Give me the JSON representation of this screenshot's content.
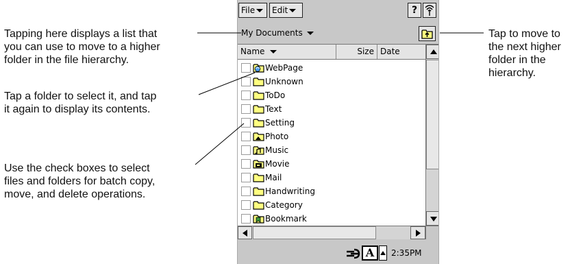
{
  "callouts": {
    "path_list": [
      "Tapping here displays a list that",
      "you can use to move to a higher",
      "folder in the file hierarchy."
    ],
    "select_folder": [
      "Tap a folder to select it, and tap",
      "it again to display its contents."
    ],
    "checkboxes": [
      "Use the check boxes to select",
      "files and folders for batch copy,",
      "move, and delete operations."
    ],
    "up_button": [
      "Tap to move to",
      "the next higher",
      "folder in the",
      "hierarchy."
    ]
  },
  "menubar": {
    "file_label": "File",
    "edit_label": "Edit",
    "help_label": "?",
    "signal_icon": "signal-icon"
  },
  "pathbar": {
    "current_folder": "My Documents",
    "up_icon": "up-folder-icon"
  },
  "list": {
    "columns": [
      "Name",
      "Size",
      "Date"
    ],
    "items": [
      {
        "name": "WebPage",
        "icon": "webpage-folder-icon"
      },
      {
        "name": "Unknown",
        "icon": "folder-icon"
      },
      {
        "name": "ToDo",
        "icon": "folder-icon"
      },
      {
        "name": "Text",
        "icon": "folder-icon"
      },
      {
        "name": "Setting",
        "icon": "folder-icon"
      },
      {
        "name": "Photo",
        "icon": "photo-folder-icon"
      },
      {
        "name": "Music",
        "icon": "music-folder-icon"
      },
      {
        "name": "Movie",
        "icon": "movie-folder-icon"
      },
      {
        "name": "Mail",
        "icon": "folder-icon"
      },
      {
        "name": "Handwriting",
        "icon": "folder-icon"
      },
      {
        "name": "Category",
        "icon": "folder-icon"
      },
      {
        "name": "Bookmark",
        "icon": "bookmark-folder-icon"
      }
    ]
  },
  "statusbar": {
    "input_label": "A",
    "time": "2:35PM"
  },
  "colors": {
    "screen_bg": "#c8c8c8",
    "folder_yellow": "#ffff80",
    "outline": "#000000"
  }
}
